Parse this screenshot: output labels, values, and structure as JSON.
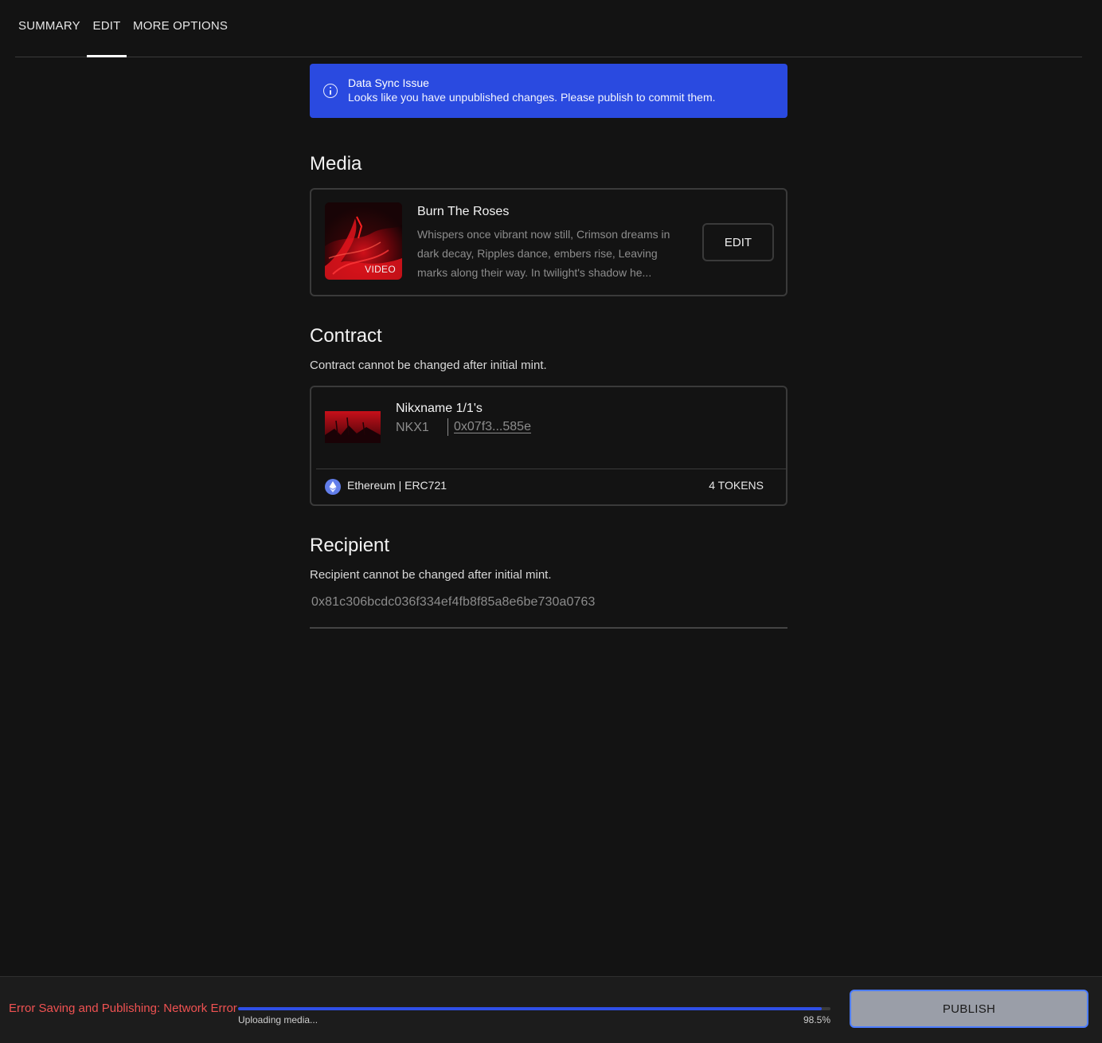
{
  "tabs": [
    {
      "label": "SUMMARY"
    },
    {
      "label": "EDIT"
    },
    {
      "label": "MORE OPTIONS"
    }
  ],
  "alert": {
    "title": "Data Sync Issue",
    "message": "Looks like you have unpublished changes. Please publish to commit them.",
    "color": "#2a4ae0"
  },
  "media": {
    "section_title": "Media",
    "item": {
      "title": "Burn The Roses",
      "description": "Whispers once vibrant now still, Crimson dreams in dark decay, Ripples dance, embers rise, Leaving marks along their way. In twilight's shadow he...",
      "badge": "VIDEO"
    },
    "edit_label": "EDIT"
  },
  "contract": {
    "section_title": "Contract",
    "subtitle": "Contract cannot be changed after initial mint.",
    "name": "Nikxname 1/1's",
    "symbol": "NKX1",
    "address": "0x07f3...585e",
    "chain": "Ethereum | ERC721",
    "tokens": "4 TOKENS"
  },
  "recipient": {
    "section_title": "Recipient",
    "subtitle": "Recipient cannot be changed after initial mint.",
    "address": "0x81c306bcdc036f334ef4fb8f85a8e6be730a0763"
  },
  "footer": {
    "error": "Error Saving and Publishing: Network Error",
    "error_color": "#f05252",
    "progress_label": "Uploading media...",
    "progress_percent_text": "98.5%",
    "progress_percent": 98.5,
    "publish_label": "PUBLISH"
  }
}
